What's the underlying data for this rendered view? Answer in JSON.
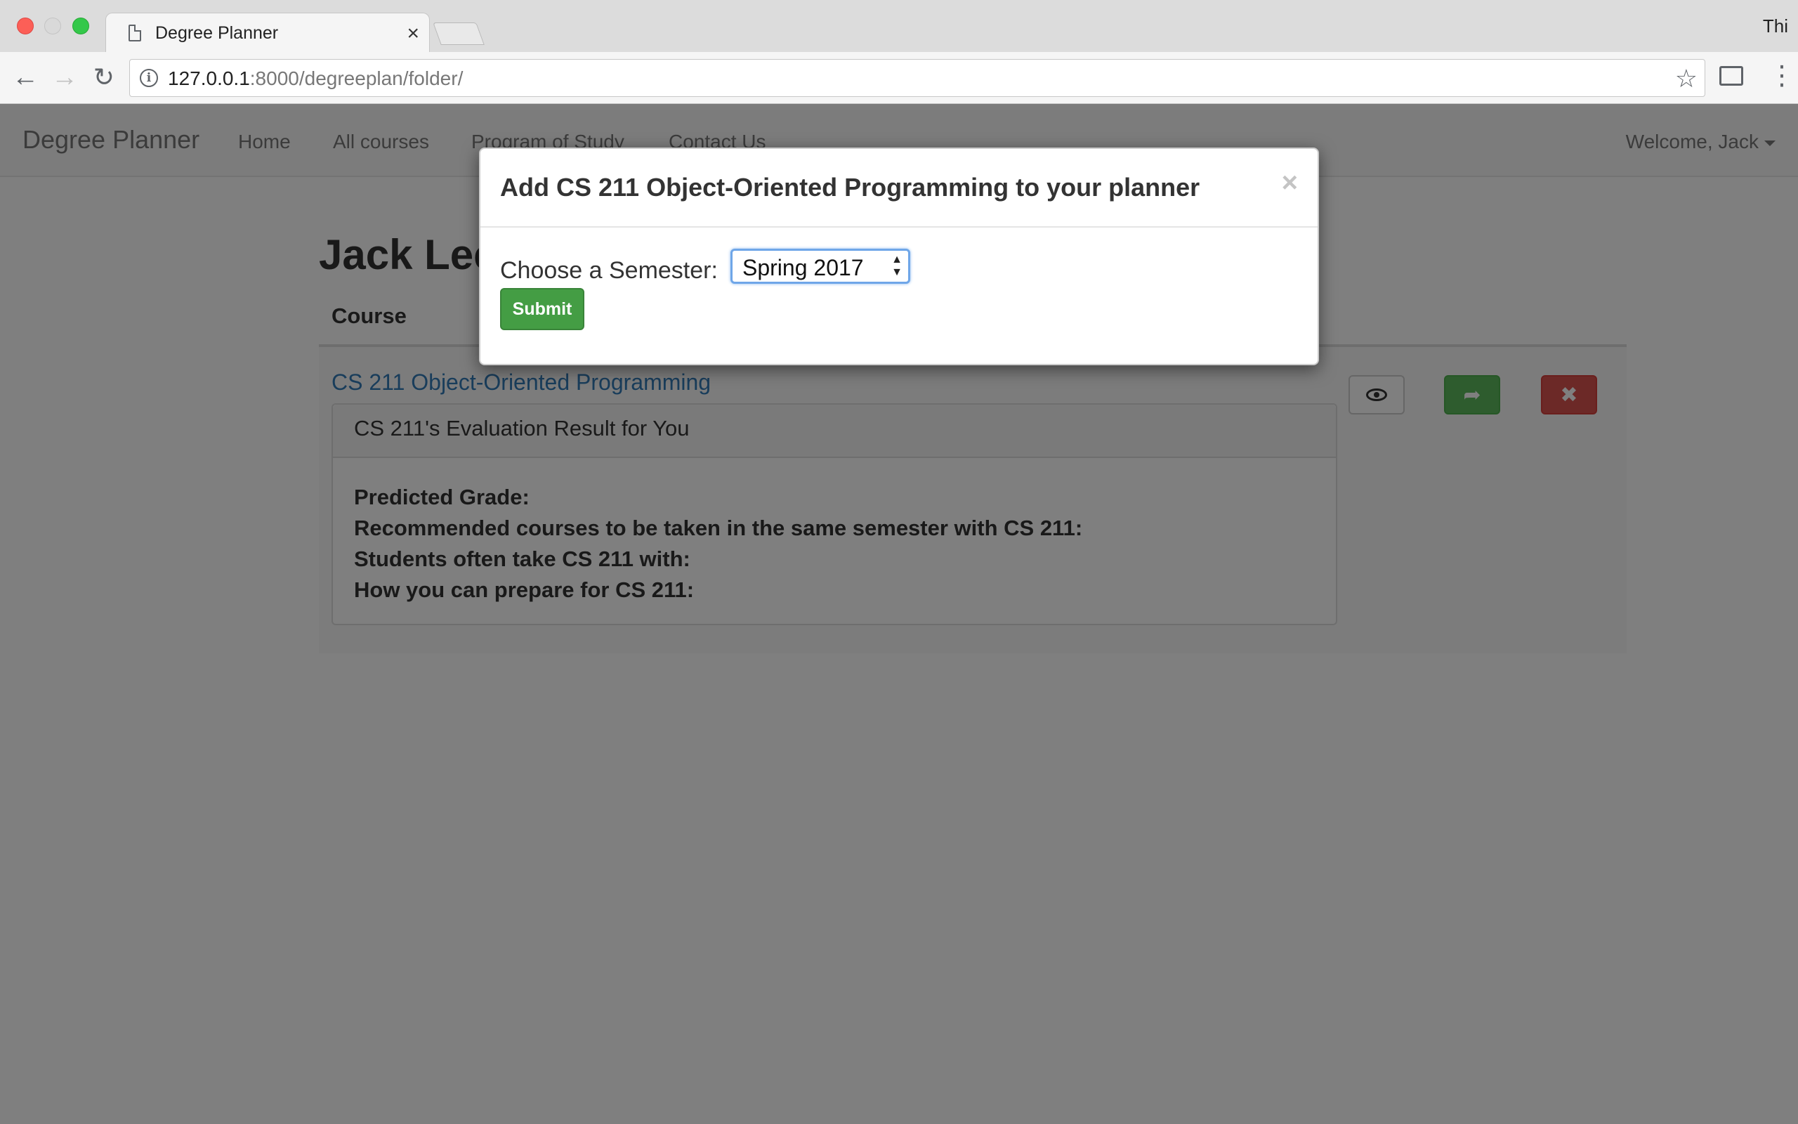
{
  "browser": {
    "tab_title": "Degree Planner",
    "tab_close": "×",
    "profile_label": "Thi",
    "url_host": "127.0.0.1",
    "url_path": ":8000/degreeplan/folder/",
    "icons": [
      "back-icon",
      "forward-icon",
      "reload-icon",
      "info-icon",
      "star-icon",
      "cast-icon",
      "menu-icon"
    ]
  },
  "navbar": {
    "brand": "Degree Planner",
    "links": [
      "Home",
      "All courses",
      "Program of Study",
      "Contact Us"
    ],
    "welcome": "Welcome, Jack"
  },
  "main": {
    "user_name": "Jack Lee",
    "table_header": "Course",
    "course_link": "CS 211 Object-Oriented Programming",
    "panel": {
      "heading": "CS 211's Evaluation Result for You",
      "lines": [
        "Predicted Grade:",
        "Recommended courses to be taken in the same semester with CS 211:",
        "Students often take CS 211 with:",
        "How you can prepare for CS 211:"
      ]
    },
    "actions": {
      "view_icon": "eye-icon",
      "move_glyph": "➦",
      "delete_glyph": "✖"
    }
  },
  "modal": {
    "title": "Add CS 211 Object-Oriented Programming to your planner",
    "close": "×",
    "semester_label": "Choose a Semester:",
    "semester_value": "Spring 2017",
    "submit_label": "Submit"
  },
  "colors": {
    "link": "#337ab7",
    "success": "#5cb85c",
    "danger": "#d9534f",
    "backdrop": "rgba(0,0,0,0.5)"
  }
}
